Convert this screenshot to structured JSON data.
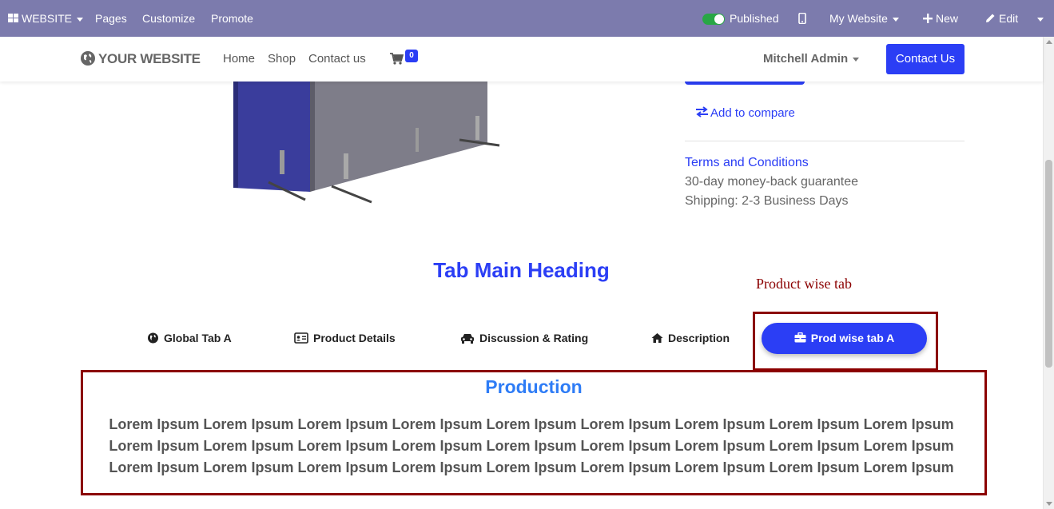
{
  "admin_bar": {
    "website_menu": "WEBSITE",
    "pages": "Pages",
    "customize": "Customize",
    "promote": "Promote",
    "published": "Published",
    "site_select": "My Website",
    "new": "New",
    "edit": "Edit"
  },
  "navbar": {
    "brand": "YOUR WEBSITE",
    "links": [
      "Home",
      "Shop",
      "Contact us"
    ],
    "cart_count": "0",
    "user": "Mitchell Admin",
    "contact_button": "Contact Us"
  },
  "product": {
    "compare": "Add to compare",
    "terms": "Terms and Conditions",
    "guarantee": "30-day money-back guarantee",
    "shipping": "Shipping: 2-3 Business Days"
  },
  "tabs": {
    "heading": "Tab Main Heading",
    "items": [
      "Global Tab A",
      "Product Details",
      "Discussion & Rating",
      "Description"
    ],
    "active": "Prod wise tab A"
  },
  "annotation": {
    "label": "Product wise tab"
  },
  "content": {
    "title": "Production",
    "body": "Lorem Ipsum Lorem Ipsum Lorem Ipsum Lorem Ipsum Lorem Ipsum Lorem Ipsum Lorem Ipsum Lorem Ipsum Lorem Ipsum Lorem Ipsum Lorem Ipsum Lorem Ipsum Lorem Ipsum Lorem Ipsum Lorem Ipsum Lorem Ipsum Lorem Ipsum Lorem Ipsum Lorem Ipsum Lorem Ipsum Lorem Ipsum Lorem Ipsum Lorem Ipsum Lorem Ipsum Lorem Ipsum Lorem Ipsum Lorem Ipsum"
  },
  "colors": {
    "admin_bar": "#7c7bad",
    "primary": "#2b3ef5",
    "annotation": "#8b0000",
    "content_title": "#2e7cf6"
  },
  "icons": [
    "apps-icon",
    "mobile-icon",
    "plus-icon",
    "pencil-icon",
    "globe-icon",
    "cart-icon",
    "exchange-icon",
    "globe-tab-icon",
    "id-card-icon",
    "car-icon",
    "home-icon",
    "briefcase-icon"
  ]
}
